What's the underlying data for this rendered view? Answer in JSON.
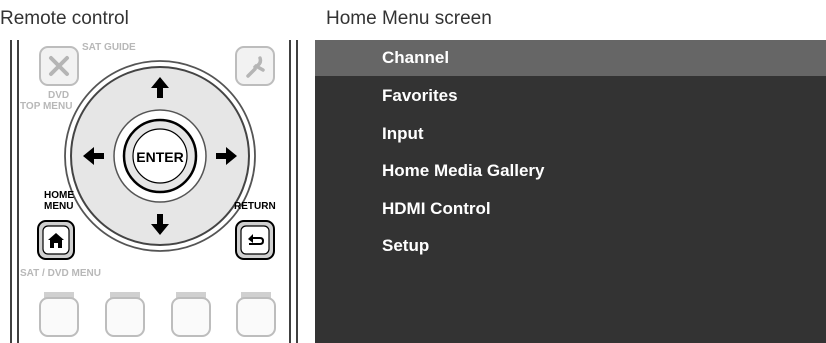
{
  "captions": {
    "remote": "Remote control",
    "screen": "Home Menu screen"
  },
  "remote": {
    "sat_guide_label": "SAT GUIDE",
    "dvd_top_menu_label_1": "DVD",
    "dvd_top_menu_label_2": "TOP MENU",
    "home_menu_label_1": "HOME",
    "home_menu_label_2": "MENU",
    "return_label": "RETURN",
    "enter_label": "ENTER",
    "sat_dvd_menu_label": "SAT / DVD MENU",
    "icons": [
      "close-icon",
      "arrow-up-icon",
      "arrow-down-icon",
      "arrow-left-icon",
      "arrow-right-icon",
      "home-icon",
      "return-icon",
      "function-icon"
    ]
  },
  "menu": {
    "selected_index": 0,
    "items": [
      {
        "label": "Channel"
      },
      {
        "label": "Favorites"
      },
      {
        "label": "Input"
      },
      {
        "label": "Home Media Gallery"
      },
      {
        "label": "HDMI Control"
      },
      {
        "label": "Setup"
      }
    ]
  },
  "colors": {
    "screen_bg": "#333333",
    "selected_bg": "#666666",
    "menu_text": "#ffffff",
    "remote_button_fill": "#e4e4e4",
    "remote_outline": "#bbbbbb"
  }
}
